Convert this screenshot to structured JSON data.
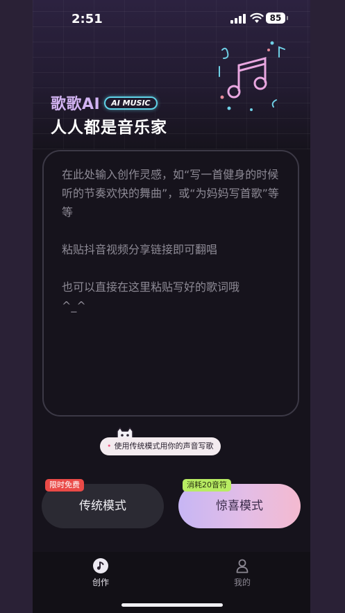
{
  "status_bar": {
    "time": "2:51",
    "battery": "85"
  },
  "brand": {
    "name": "歌歌AI",
    "badge": "AI MUSIC",
    "subtitle": "人人都是音乐家"
  },
  "prompt_input": {
    "placeholder": "在此处输入创作灵感，如“写一首健身的时候听的节奏欢快的舞曲”，或“为妈妈写首歌”等等\n\n粘贴抖音视频分享链接即可翻唱\n\n也可以直接在这里粘贴写好的歌词哦\n^_^"
  },
  "tip": {
    "text": "使用传统模式用你的声音写歌"
  },
  "modes": {
    "traditional": {
      "label": "传统模式",
      "tag": "限时免费"
    },
    "surprise": {
      "label": "惊喜模式",
      "tag": "消耗20音符"
    }
  },
  "tabbar": {
    "items": [
      {
        "label": "创作",
        "icon": "music-note-icon"
      },
      {
        "label": "我的",
        "icon": "person-icon"
      }
    ]
  },
  "colors": {
    "accent": "#d2b3f2",
    "badge_border": "#5fd3e8",
    "free_tag": "#ea4a47",
    "cost_tag": "#b8ec63"
  }
}
